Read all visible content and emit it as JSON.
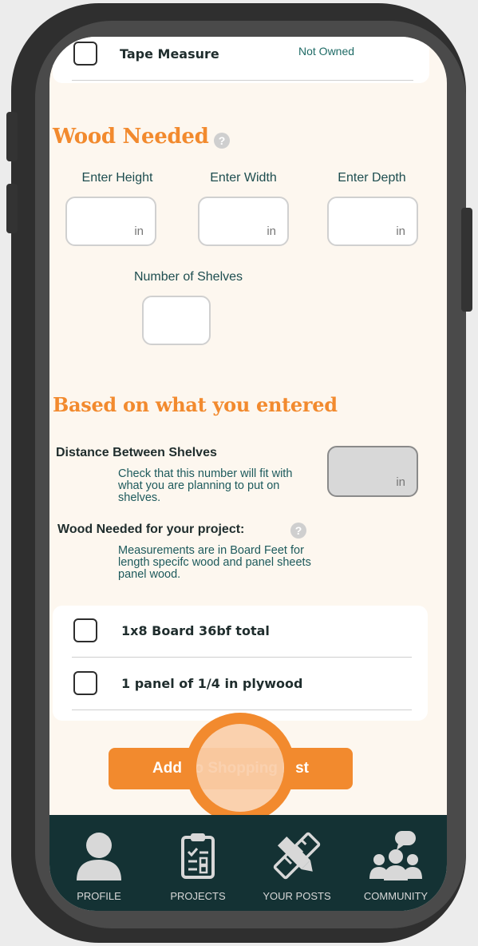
{
  "tools": {
    "items": [
      {
        "name": "Tape Measure",
        "status": "Not Owned"
      }
    ]
  },
  "wood_needed": {
    "title": "Wood Needed",
    "help_icon": "question-circle-icon",
    "fields": [
      {
        "label": "Enter Height",
        "unit": "in",
        "value": ""
      },
      {
        "label": "Enter Width",
        "unit": "in",
        "value": ""
      },
      {
        "label": "Enter Depth",
        "unit": "in",
        "value": ""
      }
    ],
    "shelves_label": "Number of Shelves",
    "shelves_value": ""
  },
  "results": {
    "title": "Based on what you entered",
    "distance_label": "Distance Between Shelves",
    "distance_note": "Check that this number will fit with what you are planning to put on shelves.",
    "distance_unit": "in",
    "wood_label": "Wood Needed for your project:",
    "wood_note": "Measurements are in Board Feet for length specifc wood and panel sheets panel wood.",
    "items": [
      {
        "label": "1x8 Board 36bf total",
        "checked": false
      },
      {
        "label": "1 panel of 1/4 in plywood",
        "checked": false
      }
    ]
  },
  "cta": {
    "label": "Add To Shopping List"
  },
  "nav": {
    "items": [
      {
        "label": "PROFILE",
        "icon": "profile-icon"
      },
      {
        "label": "PROJECTS",
        "icon": "clipboard-icon"
      },
      {
        "label": "YOUR POSTS",
        "icon": "pencil-ruler-icon"
      },
      {
        "label": "COMMUNITY",
        "icon": "community-icon"
      }
    ]
  },
  "colors": {
    "accent": "#f28a2e",
    "nav_bg": "#143234",
    "teal_text": "#1d5a5c",
    "screen_bg": "#fdf7ef"
  }
}
